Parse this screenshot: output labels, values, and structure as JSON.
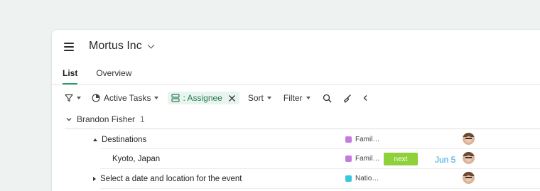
{
  "header": {
    "title": "Mortus Inc"
  },
  "tabs": [
    {
      "label": "List",
      "active": true
    },
    {
      "label": "Overview",
      "active": false
    }
  ],
  "toolbar": {
    "active_tasks": "Active Tasks",
    "assignee_chip": ": Assignee",
    "sort": "Sort",
    "filter": "Filter"
  },
  "group": {
    "name": "Brandon Fisher",
    "count": "1"
  },
  "rows": [
    {
      "name": "Destinations",
      "expanded": true,
      "project": "Famil…",
      "project_color": "#c47be0"
    },
    {
      "name": "Kyoto, Japan",
      "project": "Famil…",
      "project_color": "#c47be0",
      "status": "next",
      "status_color": "#8fd13a",
      "date": "Jun 5"
    },
    {
      "name": "Select a date and location for the event",
      "expanded": false,
      "project": "Natio…",
      "project_color": "#3cc6dd"
    }
  ]
}
